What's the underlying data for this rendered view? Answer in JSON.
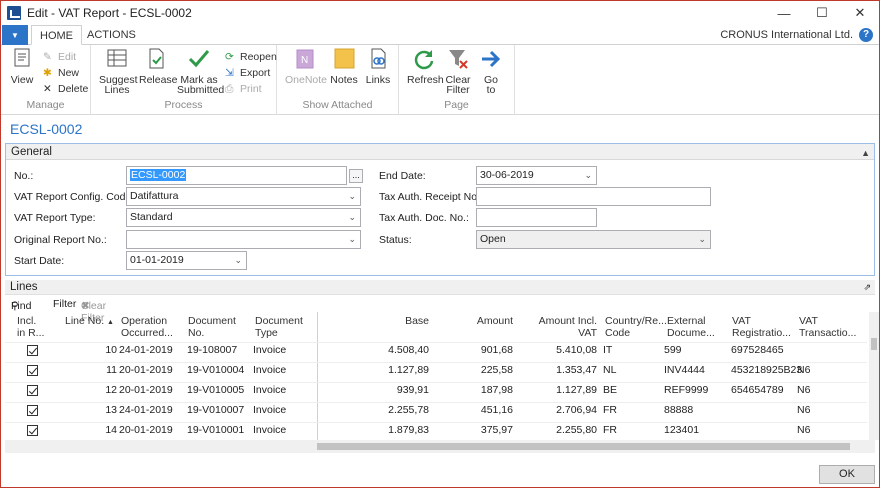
{
  "window": {
    "title": "Edit - VAT Report - ECSL-0002"
  },
  "tabs": [
    {
      "label": "HOME"
    },
    {
      "label": "ACTIONS"
    }
  ],
  "company": "CRONUS International Ltd.",
  "ribbon": {
    "manage": {
      "label": "Manage",
      "view": "View",
      "edit": "Edit",
      "new": "New",
      "delete": "Delete"
    },
    "process": {
      "label": "Process",
      "suggest_lines_1": "Suggest",
      "suggest_lines_2": "Lines",
      "release": "Release",
      "mark_1": "Mark as",
      "mark_2": "Submitted",
      "reopen": "Reopen",
      "export": "Export",
      "print": "Print"
    },
    "show_attached": {
      "label": "Show Attached",
      "onenote": "OneNote",
      "notes": "Notes",
      "links": "Links"
    },
    "page": {
      "label": "Page",
      "refresh": "Refresh",
      "clear_filter_1": "Clear",
      "clear_filter_2": "Filter",
      "goto_1": "Go",
      "goto_2": "to"
    }
  },
  "page_heading": "ECSL-0002",
  "general": {
    "title": "General",
    "no_label": "No.:",
    "no_value": "ECSL-0002",
    "config_label": "VAT Report Config. Code:",
    "config_value": "Datifattura",
    "type_label": "VAT Report Type:",
    "type_value": "Standard",
    "orig_label": "Original Report No.:",
    "orig_value": "",
    "start_label": "Start Date:",
    "start_value": "01-01-2019",
    "end_label": "End Date:",
    "end_value": "30-06-2019",
    "receipt_label": "Tax Auth. Receipt No.:",
    "receipt_value": "",
    "doc_label": "Tax Auth. Doc. No.:",
    "doc_value": "",
    "status_label": "Status:",
    "status_value": "Open"
  },
  "lines": {
    "title": "Lines",
    "find": "Find",
    "filter": "Filter",
    "clear_filter": "Clear Filter",
    "columns": {
      "incl_1": "Incl.",
      "incl_2": "in R...",
      "line_no": "Line No.",
      "op_1": "Operation",
      "op_2": "Occurred...",
      "doc_1": "Document",
      "doc_2": "No.",
      "dtype_1": "Document",
      "dtype_2": "Type",
      "base": "Base",
      "amount": "Amount",
      "amount_vat": "Amount Incl. VAT",
      "country_1": "Country/Re...",
      "country_2": "Code",
      "ext_1": "External",
      "ext_2": "Docume...",
      "vatreg_1": "VAT",
      "vatreg_2": "Registratio...",
      "vattr_1": "VAT",
      "vattr_2": "Transactio..."
    },
    "rows": [
      {
        "line": "10",
        "date": "24-01-2019",
        "doc": "19-108007",
        "type": "Invoice",
        "base": "4.508,40",
        "amount": "901,68",
        "amount_vat": "5.410,08",
        "country": "IT",
        "ext": "599",
        "vatreg": "697528465",
        "vattr": ""
      },
      {
        "line": "11",
        "date": "20-01-2019",
        "doc": "19-V010004",
        "type": "Invoice",
        "base": "1.127,89",
        "amount": "225,58",
        "amount_vat": "1.353,47",
        "country": "NL",
        "ext": "INV4444",
        "vatreg": "453218925B23",
        "vattr": "N6"
      },
      {
        "line": "12",
        "date": "20-01-2019",
        "doc": "19-V010005",
        "type": "Invoice",
        "base": "939,91",
        "amount": "187,98",
        "amount_vat": "1.127,89",
        "country": "BE",
        "ext": "REF9999",
        "vatreg": "654654789",
        "vattr": "N6"
      },
      {
        "line": "13",
        "date": "24-01-2019",
        "doc": "19-V010007",
        "type": "Invoice",
        "base": "2.255,78",
        "amount": "451,16",
        "amount_vat": "2.706,94",
        "country": "FR",
        "ext": "88888",
        "vatreg": "",
        "vattr": "N6"
      },
      {
        "line": "14",
        "date": "20-01-2019",
        "doc": "19-V010001",
        "type": "Invoice",
        "base": "1.879,83",
        "amount": "375,97",
        "amount_vat": "2.255,80",
        "country": "FR",
        "ext": "123401",
        "vatreg": "",
        "vattr": "N6"
      }
    ]
  },
  "ok_label": "OK"
}
